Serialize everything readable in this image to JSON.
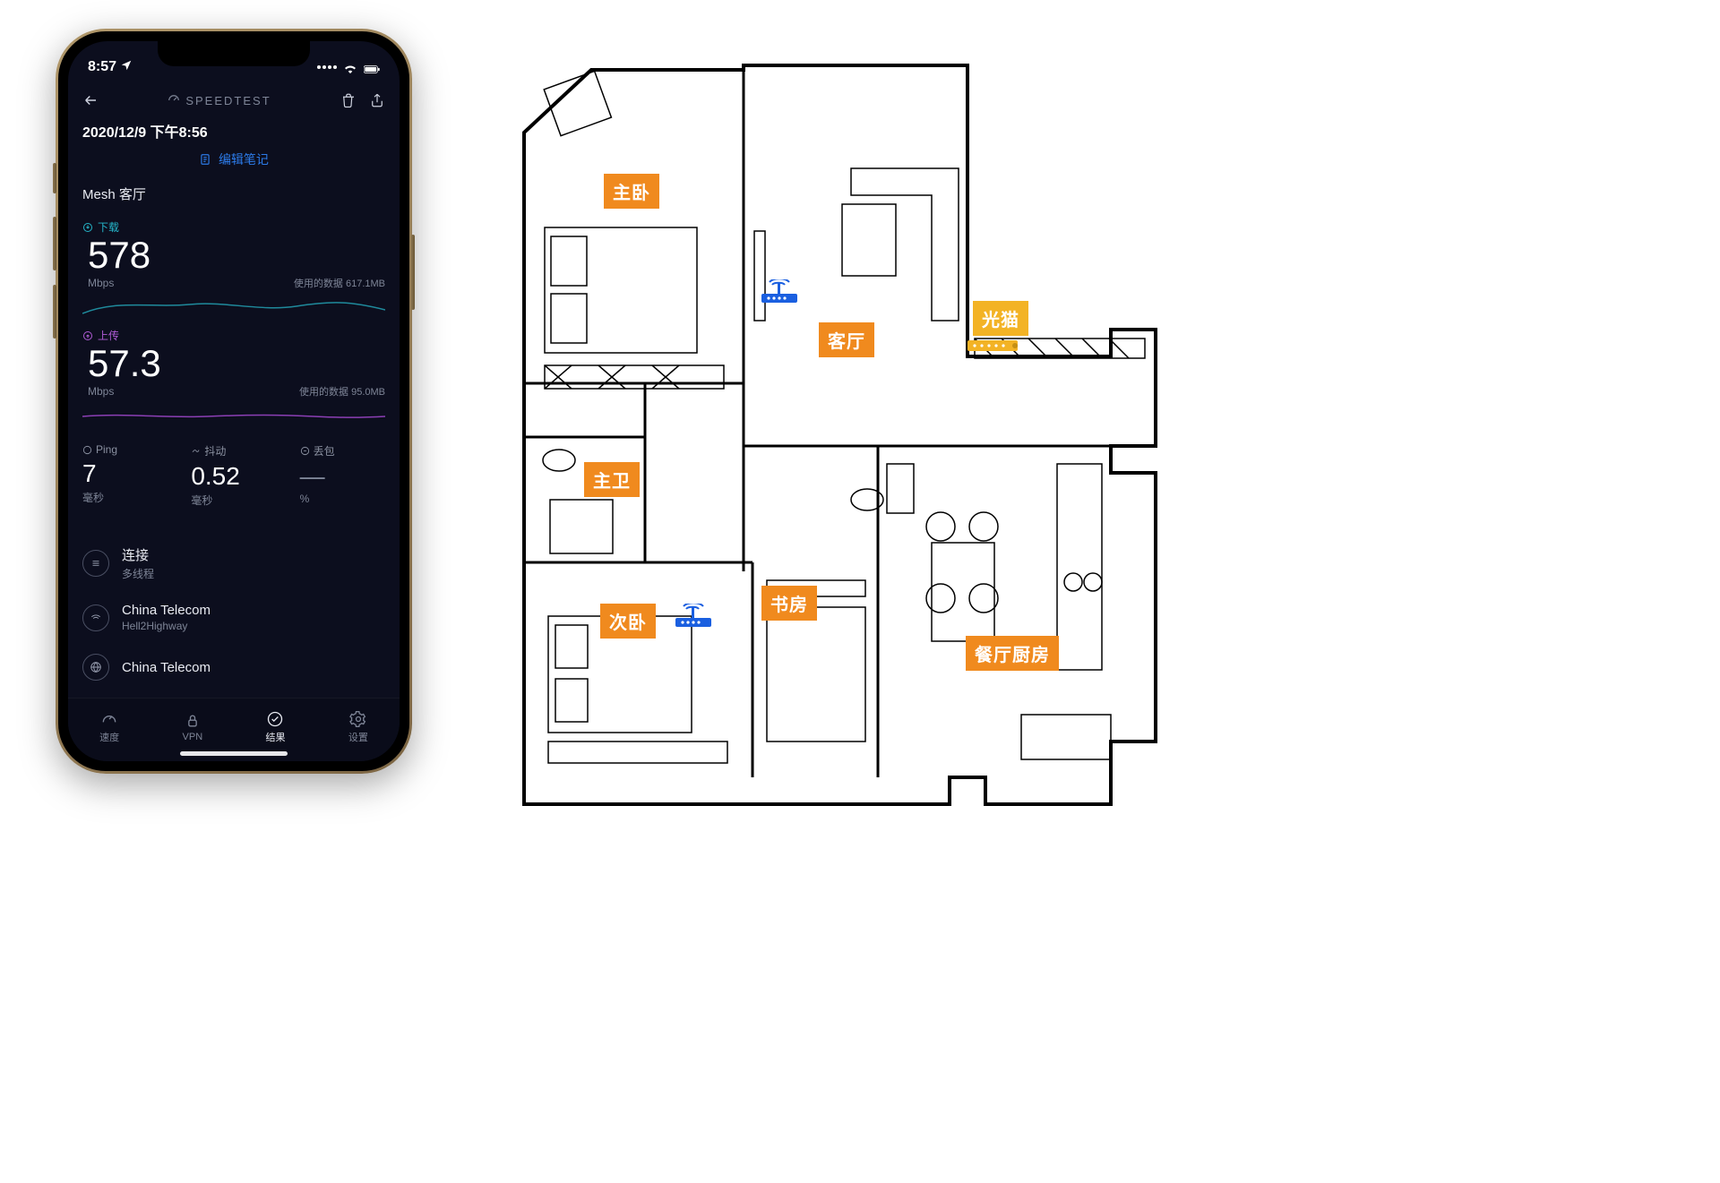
{
  "status_bar": {
    "time": "8:57",
    "battery_pct": 100
  },
  "app": {
    "brand": "SPEEDTEST",
    "timestamp": "2020/12/9 下午8:56",
    "edit_notes_label": "编辑笔记",
    "location_label": "Mesh 客厅",
    "download": {
      "label": "下载",
      "value": "578",
      "unit": "Mbps",
      "data_used": "使用的数据 617.1MB",
      "color": "#25b5c9"
    },
    "upload": {
      "label": "上传",
      "value": "57.3",
      "unit": "Mbps",
      "data_used": "使用的数据 95.0MB",
      "color": "#b05cd6"
    },
    "ping": {
      "label": "Ping",
      "value": "7",
      "unit": "毫秒"
    },
    "jitter": {
      "label": "抖动",
      "value": "0.52",
      "unit": "毫秒"
    },
    "loss": {
      "label": "丢包",
      "value": "—",
      "unit": "%"
    },
    "conn": {
      "title": "连接",
      "subtitle": "多线程"
    },
    "isp1": {
      "title": "China Telecom",
      "subtitle": "Hell2Highway"
    },
    "isp2": {
      "title": "China Telecom",
      "subtitle": ""
    },
    "tabs": {
      "speed": "速度",
      "vpn": "VPN",
      "results": "结果",
      "settings": "设置"
    }
  },
  "floor_plan": {
    "rooms": {
      "master_bedroom": "主卧",
      "living_room": "客厅",
      "modem": "光猫",
      "master_bath": "主卫",
      "second_bedroom": "次卧",
      "study": "书房",
      "dining_kitchen": "餐厅厨房"
    },
    "devices": {
      "router_count": 2,
      "modem_count": 1,
      "router_color": "#1a5fe0",
      "modem_color": "#f3b325"
    }
  }
}
